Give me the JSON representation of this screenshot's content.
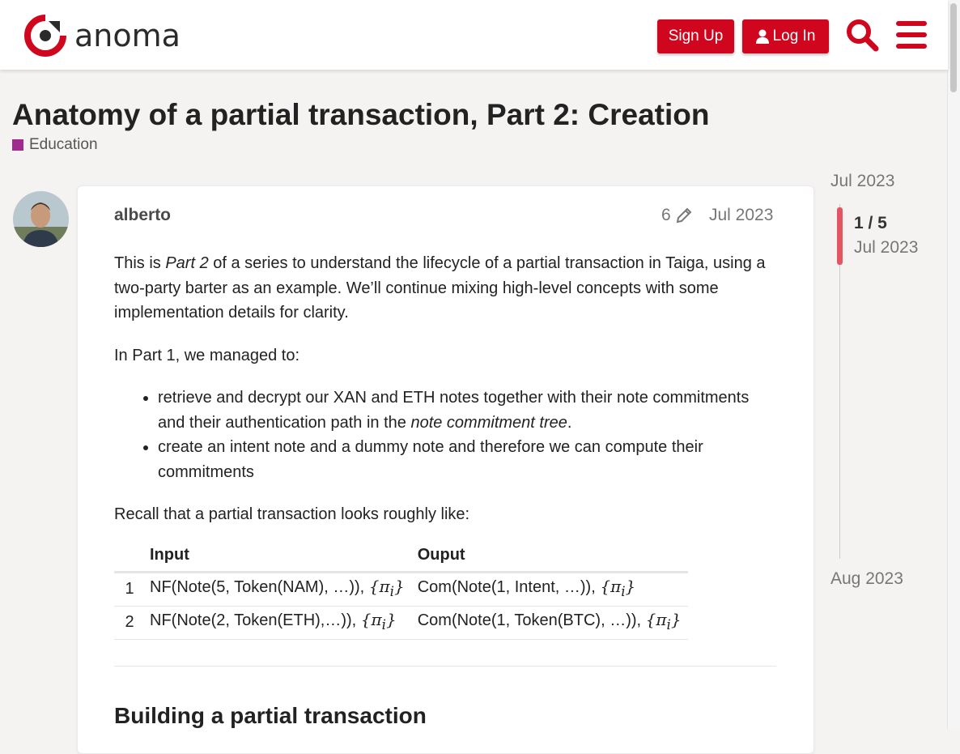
{
  "header": {
    "logo_text": "anoma",
    "signup_label": "Sign Up",
    "login_label": "Log In",
    "brand_color": "#d0061f"
  },
  "topic": {
    "title": "Anatomy of a partial transaction, Part 2: Creation",
    "category": "Education",
    "category_color": "#a02a8e"
  },
  "post": {
    "username": "alberto",
    "edit_count": "6",
    "date": "Jul 2023",
    "p1_a": "This is ",
    "p1_em": "Part 2",
    "p1_b": " of a series to understand the lifecycle of a partial transaction in Taiga, using a two-party barter as an example. We’ll continue mixing high-level concepts with some implementation details for clarity.",
    "p2": "In Part 1, we managed to:",
    "li1_a": "retrieve and decrypt our XAN and ETH notes together with their note commitments and their authentication path in the ",
    "li1_em": "note commitment tree",
    "li1_b": ".",
    "li2": "create an intent note and a dummy note and therefore we can compute their commitments",
    "p3": "Recall that a partial transaction looks roughly like:",
    "table": {
      "headers": [
        "",
        "Input",
        "Ouput"
      ],
      "rows": [
        {
          "num": "1",
          "input": "NF(Note(5, Token(NAM), …)), ",
          "output": "Com(Note(1, Intent, …)), "
        },
        {
          "num": "2",
          "input": "NF(Note(2, Token(ETH),…)), ",
          "output": "Com(Note(1, Token(BTC), …)), "
        }
      ],
      "math": "{π",
      "math_sub": "i",
      "math_close": "}"
    },
    "h2": "Building a partial transaction"
  },
  "timeline": {
    "start": "Jul 2023",
    "position": "1 / 5",
    "position_date": "Jul 2023",
    "end": "Aug 2023"
  },
  "icons": [
    "logo-icon",
    "user-icon",
    "search-icon",
    "hamburger-menu-icon",
    "pencil-icon"
  ]
}
